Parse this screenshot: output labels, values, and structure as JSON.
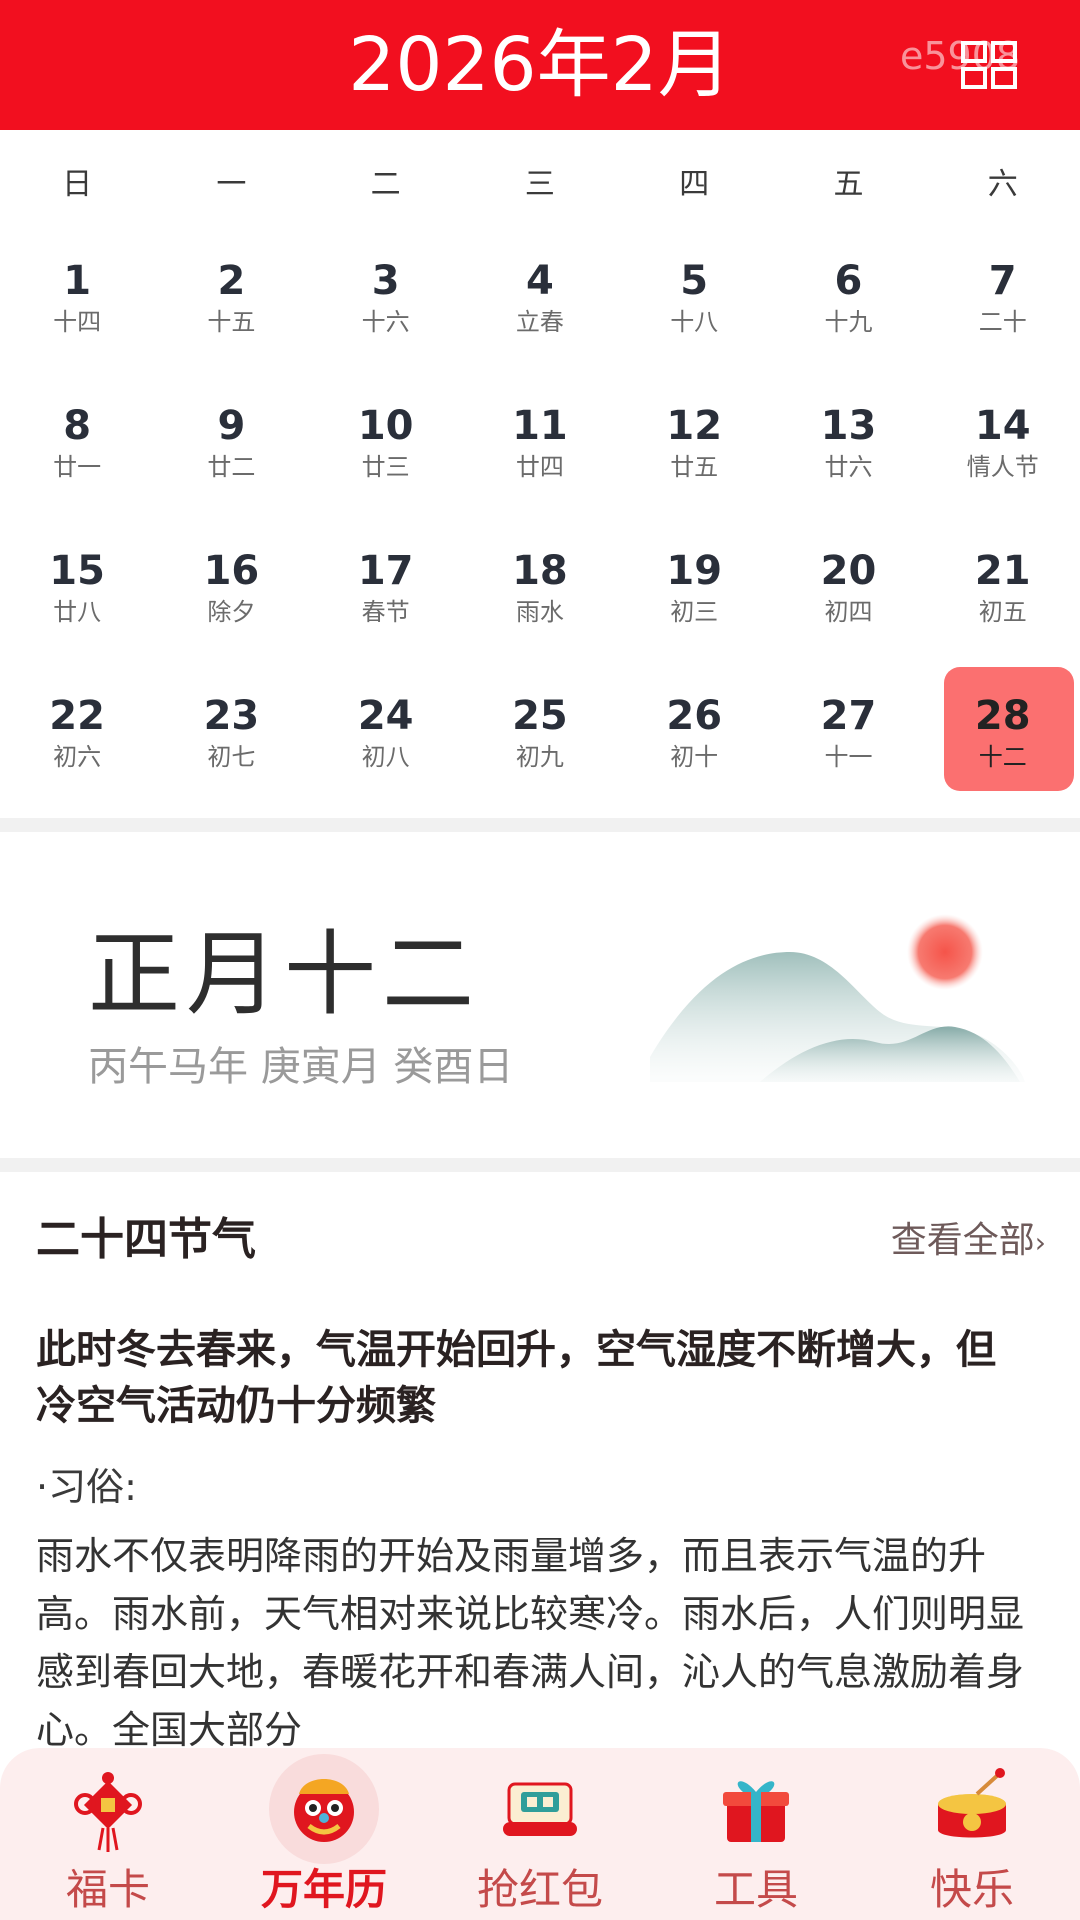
{
  "header": {
    "title": "2026年2月",
    "watermark": "e5908",
    "grid_icon": "grid-icon"
  },
  "calendar": {
    "weekdays": [
      "日",
      "一",
      "二",
      "三",
      "四",
      "五",
      "六"
    ],
    "weeks": [
      [
        {
          "day": "1",
          "lunar": "十四"
        },
        {
          "day": "2",
          "lunar": "十五"
        },
        {
          "day": "3",
          "lunar": "十六"
        },
        {
          "day": "4",
          "lunar": "立春"
        },
        {
          "day": "5",
          "lunar": "十八"
        },
        {
          "day": "6",
          "lunar": "十九"
        },
        {
          "day": "7",
          "lunar": "二十"
        }
      ],
      [
        {
          "day": "8",
          "lunar": "廿一"
        },
        {
          "day": "9",
          "lunar": "廿二"
        },
        {
          "day": "10",
          "lunar": "廿三"
        },
        {
          "day": "11",
          "lunar": "廿四"
        },
        {
          "day": "12",
          "lunar": "廿五"
        },
        {
          "day": "13",
          "lunar": "廿六"
        },
        {
          "day": "14",
          "lunar": "情人节"
        }
      ],
      [
        {
          "day": "15",
          "lunar": "廿八"
        },
        {
          "day": "16",
          "lunar": "除夕"
        },
        {
          "day": "17",
          "lunar": "春节"
        },
        {
          "day": "18",
          "lunar": "雨水"
        },
        {
          "day": "19",
          "lunar": "初三"
        },
        {
          "day": "20",
          "lunar": "初四"
        },
        {
          "day": "21",
          "lunar": "初五"
        }
      ],
      [
        {
          "day": "22",
          "lunar": "初六"
        },
        {
          "day": "23",
          "lunar": "初七"
        },
        {
          "day": "24",
          "lunar": "初八"
        },
        {
          "day": "25",
          "lunar": "初九"
        },
        {
          "day": "26",
          "lunar": "初十"
        },
        {
          "day": "27",
          "lunar": "十一"
        },
        {
          "day": "28",
          "lunar": "十二",
          "selected": true
        }
      ]
    ],
    "selected_color": "#fb7070"
  },
  "lunar_info": {
    "date": "正月十二",
    "ganzhi": "丙午马年 庚寅月 癸酉日",
    "art_icon": "mountain-sun-icon"
  },
  "solar_term": {
    "heading": "二十四节气",
    "view_all": "查看全部",
    "summary": "此时冬去春来，气温开始回升，空气湿度不断增大，但冷空气活动仍十分频繁",
    "custom_label": "·习俗:",
    "custom_body": "雨水不仅表明降雨的开始及雨量增多，而且表示气温的升高。雨水前，天气相对来说比较寒冷。雨水后，人们则明显感到春回大地，春暖花开和春满人间，沁人的气息激励着身心。全国大部分"
  },
  "bottom_nav": {
    "items": [
      {
        "label": "福卡",
        "icon": "chinese-knot-icon"
      },
      {
        "label": "万年历",
        "icon": "lion-head-icon",
        "active": true
      },
      {
        "label": "抢红包",
        "icon": "scroll-icon"
      },
      {
        "label": "工具",
        "icon": "gift-box-icon"
      },
      {
        "label": "快乐",
        "icon": "drum-icon"
      }
    ]
  },
  "colors": {
    "header_bg": "#f20f1f",
    "nav_bg": "#fdeeee",
    "nav_active": "#e0161f",
    "nav_label": "#c44a4a"
  }
}
